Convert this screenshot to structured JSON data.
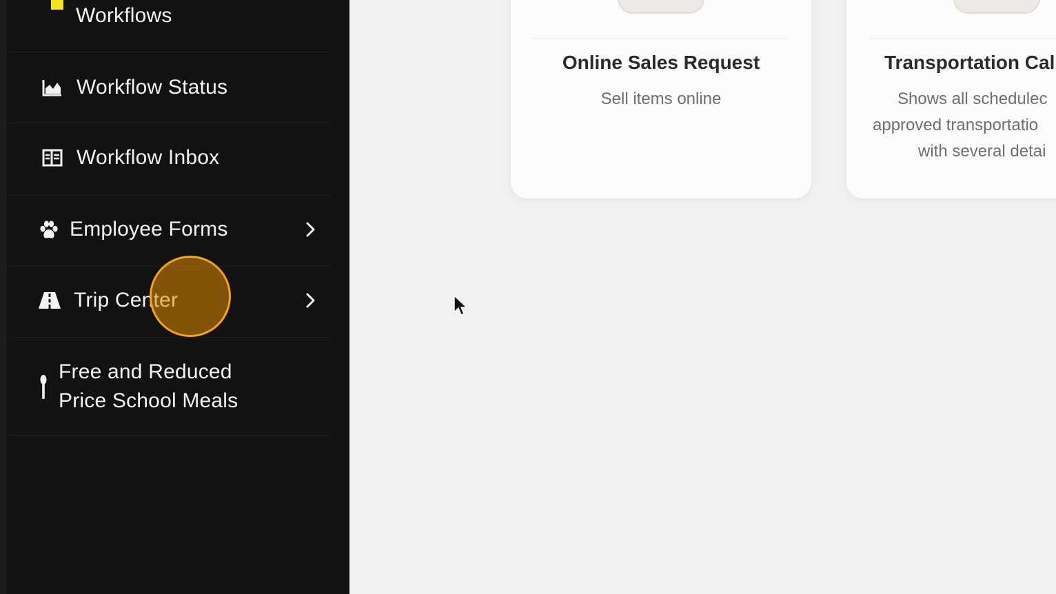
{
  "sidebar": {
    "items": [
      {
        "label": "Workflows",
        "icon": "workflows-icon"
      },
      {
        "label": "Workflow Status",
        "icon": "chart-area-icon"
      },
      {
        "label": "Workflow Inbox",
        "icon": "inbox-icon"
      },
      {
        "label": "Employee Forms",
        "icon": "paw-icon",
        "has_submenu": true
      },
      {
        "label": "Trip Center",
        "icon": "road-icon",
        "has_submenu": true
      },
      {
        "label_line1": "Free and Reduced",
        "label_line2": "Price School Meals",
        "icon": "utensils-icon"
      }
    ]
  },
  "cards": [
    {
      "title": "Online Sales Request",
      "description": [
        "Sell items online"
      ]
    },
    {
      "title": "Transportation Cal",
      "description": [
        "Shows all schedulec",
        "approved transportatio",
        "with several detai"
      ]
    }
  ],
  "colors": {
    "sidebar_bg": "#131213",
    "main_bg": "#f1f1f1",
    "accent_yellow": "#f3e61b",
    "click_highlight": "#f5a31a"
  }
}
